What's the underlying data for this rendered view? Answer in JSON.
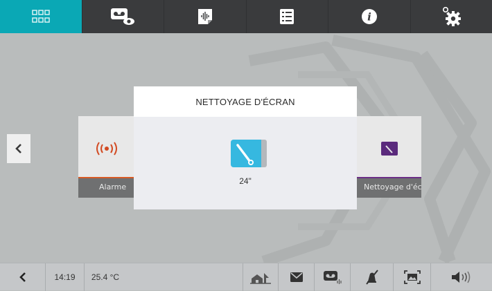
{
  "top_nav": {
    "tabs": [
      {
        "icon": "apps-grid-icon",
        "active": true
      },
      {
        "icon": "voicemail-view-icon",
        "active": false
      },
      {
        "icon": "audio-message-icon",
        "active": false
      },
      {
        "icon": "list-icon",
        "active": false
      },
      {
        "icon": "info-icon",
        "active": false
      },
      {
        "icon": "settings-gear-icon",
        "active": false
      }
    ],
    "accent_color": "#0aa8b5"
  },
  "cards": {
    "alarm": {
      "label": "Alarme",
      "icon": "alarm-signal-icon",
      "accent_color": "#d85a24"
    },
    "screen_cleaning": {
      "label": "Nettoyage d'écran",
      "icon": "screen-cleaning-icon",
      "accent_color": "#6b2e86"
    }
  },
  "modal": {
    "title": "NETTOYAGE D'ÉCRAN",
    "icon": "screen-cleaning-icon",
    "countdown": "24\""
  },
  "status_bar": {
    "time": "14:19",
    "temperature": "25.4 °C",
    "icons": [
      "back-chevron-icon",
      "home-away-icon",
      "envelope-icon",
      "voicemail-icon",
      "mute-icon",
      "photo-frame-icon",
      "volume-icon"
    ]
  }
}
